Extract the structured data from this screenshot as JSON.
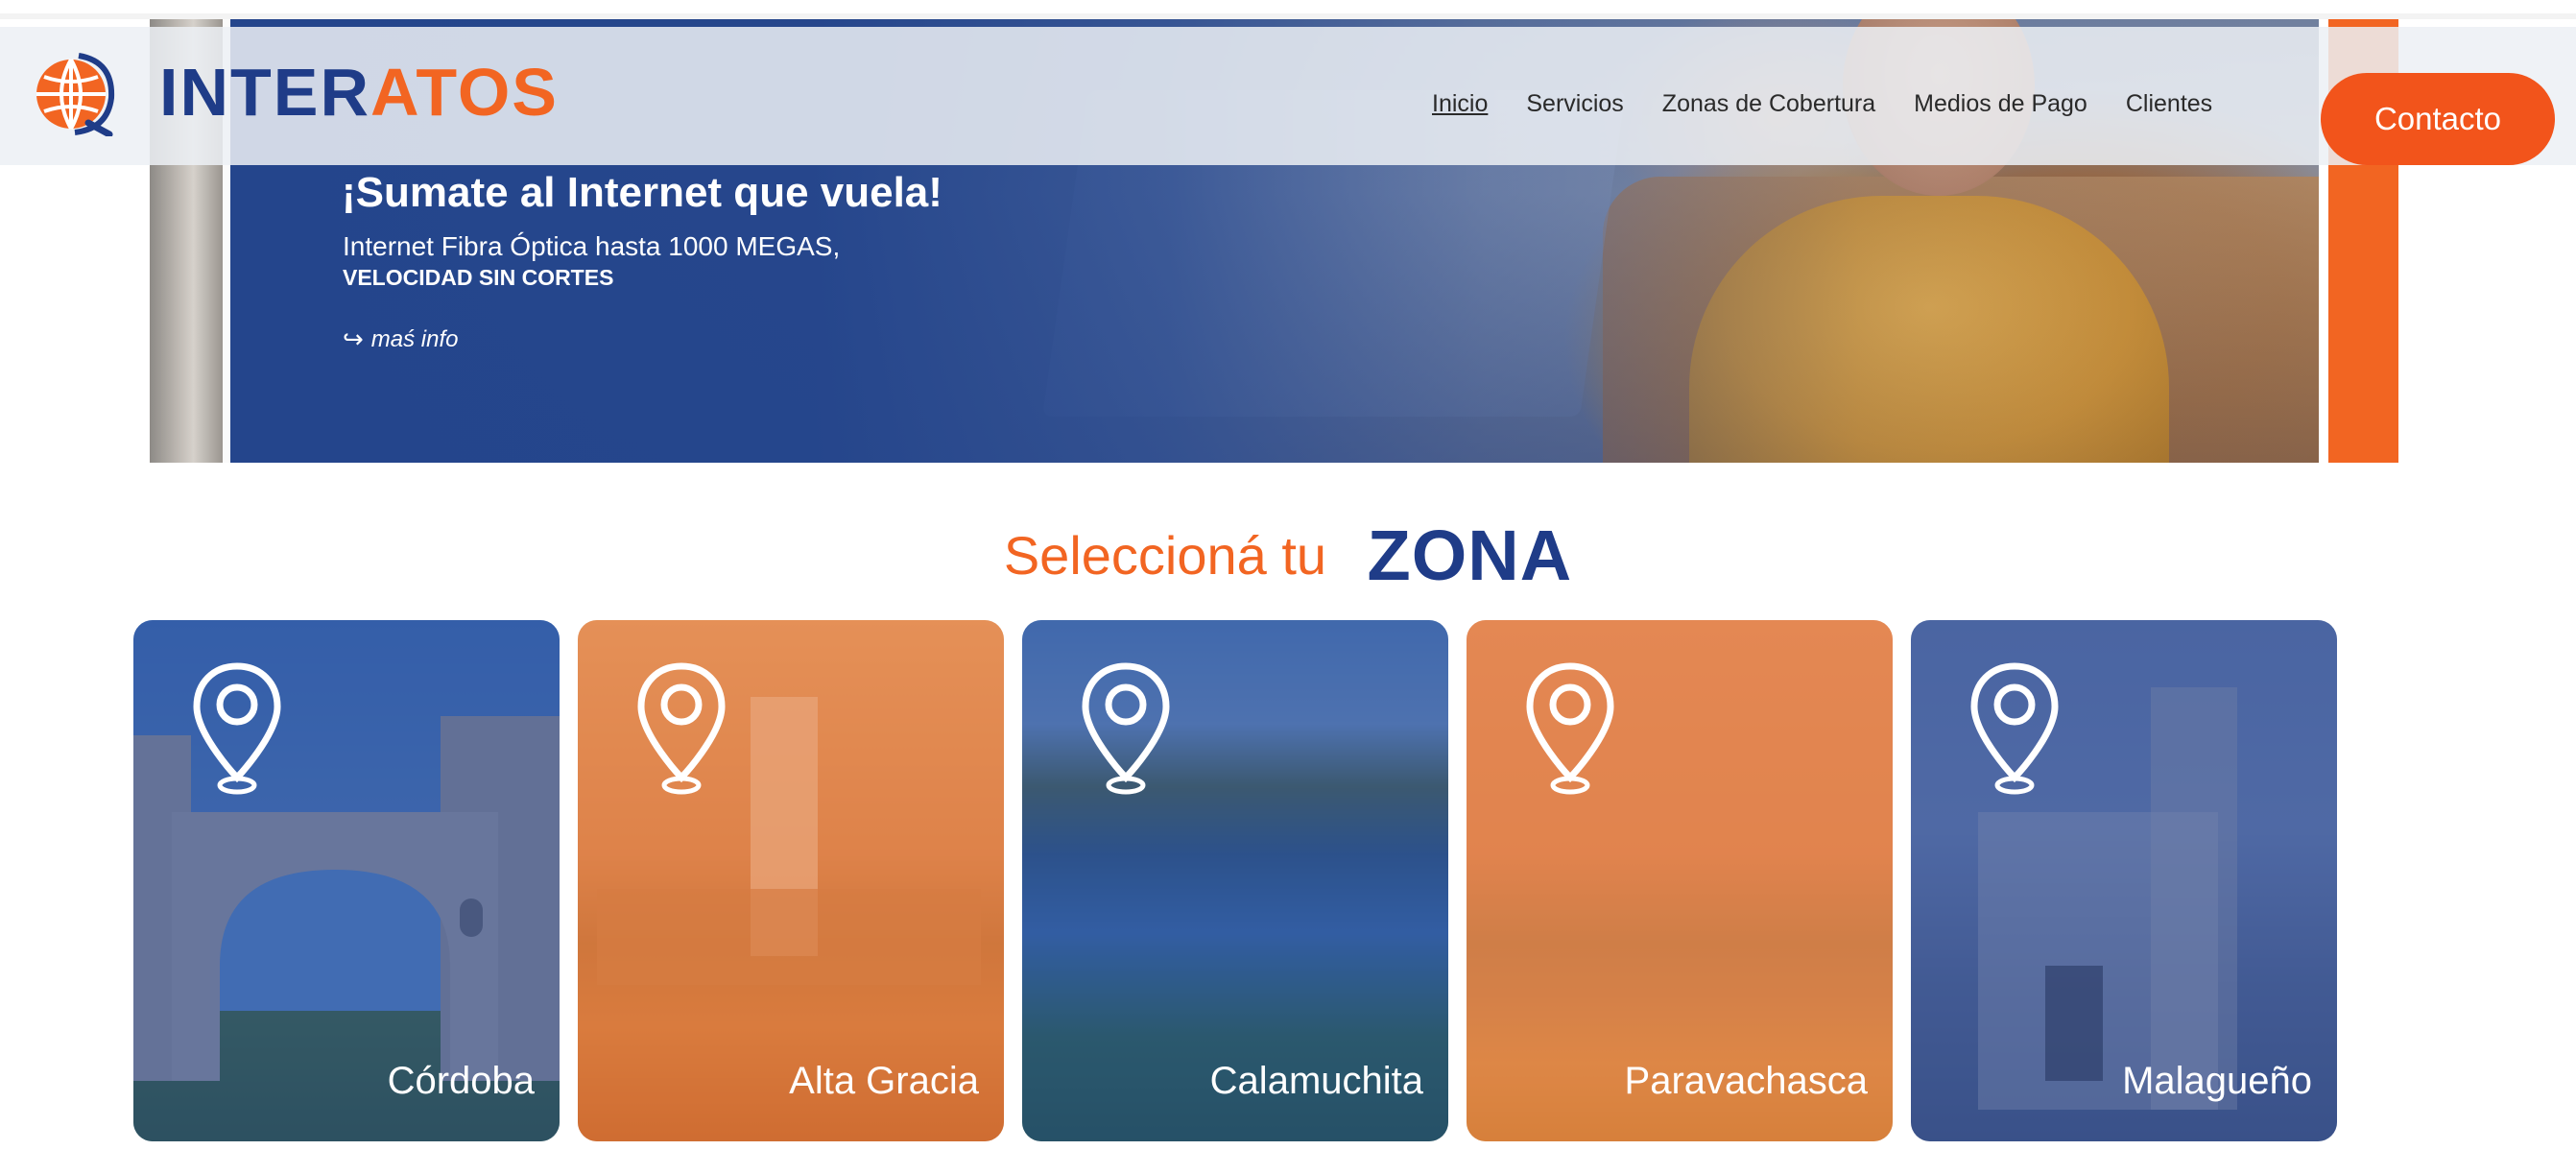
{
  "brand": {
    "logo_part1": "INTER",
    "logo_part2": "ATOS",
    "primary_color": "#1f3c88",
    "accent_color": "#f26522"
  },
  "nav": {
    "items": [
      {
        "label": "Inicio",
        "active": true
      },
      {
        "label": "Servicios"
      },
      {
        "label": "Zonas de Cobertura"
      },
      {
        "label": "Medios de Pago"
      },
      {
        "label": "Clientes"
      }
    ],
    "contact_label": "Contacto"
  },
  "hero": {
    "title": "¡Sumate al Internet que vuela!",
    "subtitle": "Internet Fibra Óptica hasta 1000 MEGAS,",
    "subtitle_bold": "VELOCIDAD SIN CORTES",
    "more_arrow": "↪",
    "more_label": "maś info"
  },
  "zones": {
    "heading_light": "Seleccioná tu",
    "heading_bold": "ZONA",
    "cards": [
      {
        "label": "Córdoba",
        "icon": "map-pin-icon"
      },
      {
        "label": "Alta Gracia",
        "icon": "map-pin-icon"
      },
      {
        "label": "Calamuchita",
        "icon": "map-pin-icon"
      },
      {
        "label": "Paravachasca",
        "icon": "map-pin-icon"
      },
      {
        "label": "Malagueño",
        "icon": "map-pin-icon"
      }
    ]
  }
}
